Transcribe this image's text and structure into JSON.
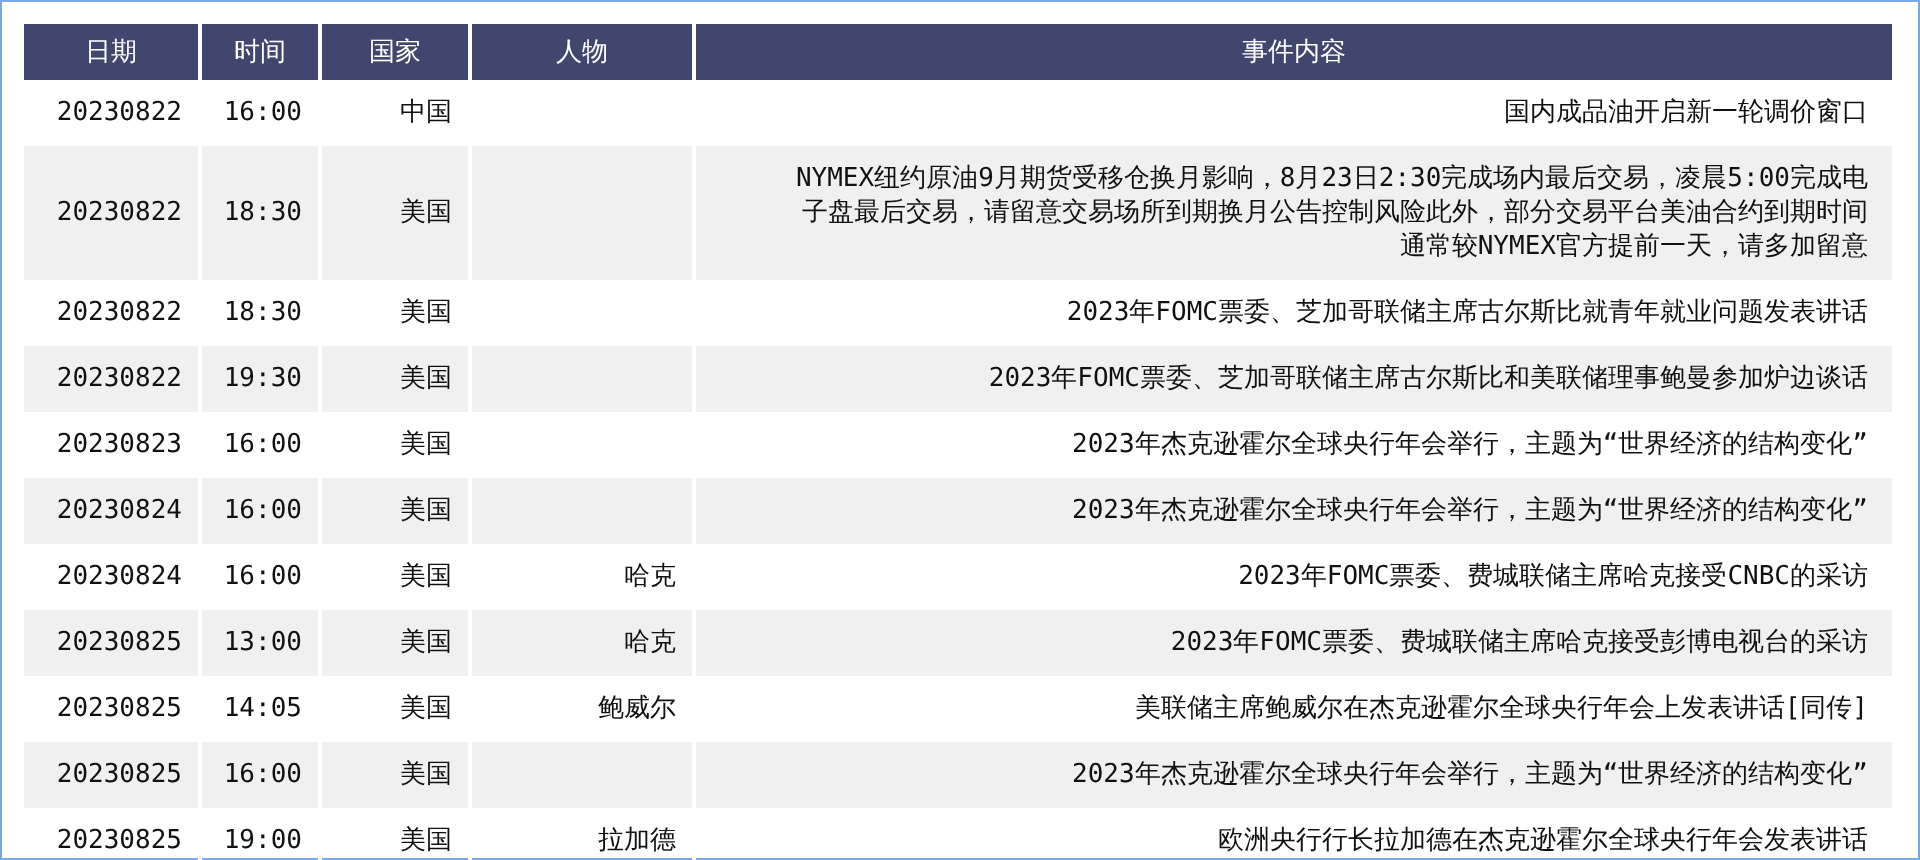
{
  "table": {
    "columns": [
      "日期",
      "时间",
      "国家",
      "人物",
      "事件内容"
    ],
    "rows": [
      {
        "date": "20230822",
        "time": "16:00",
        "country": "中国",
        "person": "",
        "event": "国内成品油开启新一轮调价窗口"
      },
      {
        "date": "20230822",
        "time": "18:30",
        "country": "美国",
        "person": "",
        "event": "NYMEX纽约原油9月期货受移仓换月影响，8月23日2:30完成场内最后交易，凌晨5:00完成电子盘最后交易，请留意交易场所到期换月公告控制风险此外，部分交易平台美油合约到期时间通常较NYMEX官方提前一天，请多加留意"
      },
      {
        "date": "20230822",
        "time": "18:30",
        "country": "美国",
        "person": "",
        "event": "2023年FOMC票委、芝加哥联储主席古尔斯比就青年就业问题发表讲话"
      },
      {
        "date": "20230822",
        "time": "19:30",
        "country": "美国",
        "person": "",
        "event": "2023年FOMC票委、芝加哥联储主席古尔斯比和美联储理事鲍曼参加炉边谈话"
      },
      {
        "date": "20230823",
        "time": "16:00",
        "country": "美国",
        "person": "",
        "event": "2023年杰克逊霍尔全球央行年会举行，主题为“世界经济的结构变化”"
      },
      {
        "date": "20230824",
        "time": "16:00",
        "country": "美国",
        "person": "",
        "event": "2023年杰克逊霍尔全球央行年会举行，主题为“世界经济的结构变化”"
      },
      {
        "date": "20230824",
        "time": "16:00",
        "country": "美国",
        "person": "哈克",
        "event": "2023年FOMC票委、费城联储主席哈克接受CNBC的采访"
      },
      {
        "date": "20230825",
        "time": "13:00",
        "country": "美国",
        "person": "哈克",
        "event": "2023年FOMC票委、费城联储主席哈克接受彭博电视台的采访"
      },
      {
        "date": "20230825",
        "time": "14:05",
        "country": "美国",
        "person": "鲍威尔",
        "event": "美联储主席鲍威尔在杰克逊霍尔全球央行年会上发表讲话[同传]"
      },
      {
        "date": "20230825",
        "time": "16:00",
        "country": "美国",
        "person": "",
        "event": "2023年杰克逊霍尔全球央行年会举行，主题为“世界经济的结构变化”"
      },
      {
        "date": "20230825",
        "time": "19:00",
        "country": "美国",
        "person": "拉加德",
        "event": "欧洲央行行长拉加德在杰克逊霍尔全球央行年会发表讲话"
      }
    ]
  }
}
